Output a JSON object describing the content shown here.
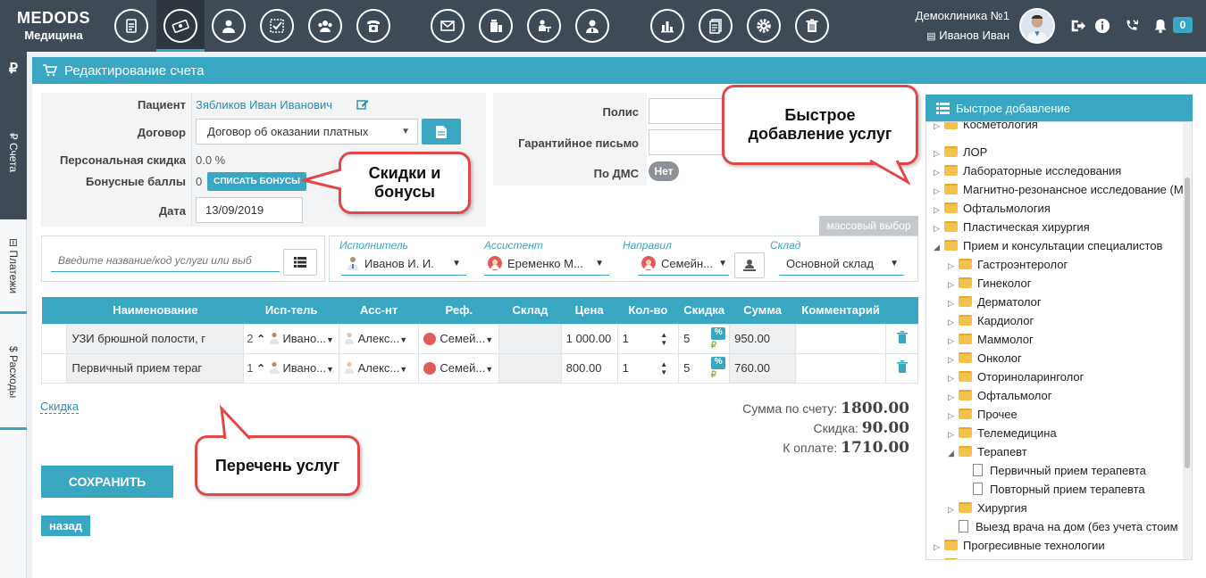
{
  "brand": {
    "name": "MEDODS",
    "sub": "Медицина"
  },
  "topbar": {
    "clinic": "Демоклиника №1",
    "user": "Иванов Иван",
    "notifications": "0"
  },
  "sidebar": {
    "currency": "₽",
    "tabs": [
      "₽ Счета",
      "⊟ Платежи",
      "$ Расходы"
    ]
  },
  "page": {
    "title": "Редактирование счета"
  },
  "patient": {
    "label_patient": "Пациент",
    "name": "Зябликов Иван Иванович",
    "label_contract": "Договор",
    "contract": "Договор об оказании платных",
    "label_discount": "Персональная скидка",
    "discount": "0.0 %",
    "label_bonus": "Бонусные баллы",
    "bonus": "0",
    "bonus_button": "СПИСАТЬ БОНУСЫ",
    "label_date": "Дата",
    "date": "13/09/2019"
  },
  "insurance": {
    "label_policy": "Полис",
    "label_letter": "Гарантийное письмо",
    "label_dms": "По ДМС",
    "dms_toggle": "Нет"
  },
  "mass_select": "массовый выбор",
  "search": {
    "placeholder": "Введите название/код услуги или выб"
  },
  "filters": {
    "performer_label": "Исполнитель",
    "performer": "Иванов И. И.",
    "assistant_label": "Ассистент",
    "assistant": "Еременко М...",
    "referrer_label": "Направил",
    "referrer": "Семейн...",
    "warehouse_label": "Склад",
    "warehouse": "Основной склад"
  },
  "table": {
    "headers": [
      "Наименование",
      "Исп-тель",
      "Асс-нт",
      "Реф.",
      "Склад",
      "Цена",
      "Кол-во",
      "Скидка",
      "Сумма",
      "Комментарий"
    ],
    "rows": [
      {
        "name": "УЗИ брюшной полости, г",
        "order": "2",
        "performer": "Ивано...",
        "assistant": "Алекс...",
        "ref": "Семей...",
        "price": "1 000.00",
        "qty": "1",
        "discount": "5",
        "sum": "950.00"
      },
      {
        "name": "Первичный прием тераг",
        "order": "1",
        "performer": "Ивано...",
        "assistant": "Алекс...",
        "ref": "Семей...",
        "price": "800.00",
        "qty": "1",
        "discount": "5",
        "sum": "760.00"
      }
    ]
  },
  "discount_link": "Скидка",
  "totals": {
    "sum_label": "Сумма по счету:",
    "sum": "1800.00",
    "discount_label": "Скидка:",
    "discount": "90.00",
    "pay_label": "К оплате:",
    "pay": "1710.00"
  },
  "actions": {
    "save": "СОХРАНИТЬ",
    "back": "назад"
  },
  "quick_add": {
    "title": "Быстрое добавление",
    "items": [
      {
        "label": "Косметология",
        "level": 0,
        "type": "folder"
      },
      {
        "label": "ЛОР",
        "level": 0,
        "type": "folder"
      },
      {
        "label": "Лабораторные исследования",
        "level": 0,
        "type": "folder"
      },
      {
        "label": "Магнитно-резонансное исследование (М",
        "level": 0,
        "type": "folder"
      },
      {
        "label": "Офтальмология",
        "level": 0,
        "type": "folder"
      },
      {
        "label": "Пластическая хирургия",
        "level": 0,
        "type": "folder"
      },
      {
        "label": "Прием и консультации специалистов",
        "level": 0,
        "type": "folder-open"
      },
      {
        "label": "Гастроэнтеролог",
        "level": 1,
        "type": "folder"
      },
      {
        "label": "Гинеколог",
        "level": 1,
        "type": "folder"
      },
      {
        "label": "Дерматолог",
        "level": 1,
        "type": "folder"
      },
      {
        "label": "Кардиолог",
        "level": 1,
        "type": "folder"
      },
      {
        "label": "Маммолог",
        "level": 1,
        "type": "folder"
      },
      {
        "label": "Онколог",
        "level": 1,
        "type": "folder"
      },
      {
        "label": "Оториноларинголог",
        "level": 1,
        "type": "folder"
      },
      {
        "label": "Офтальмолог",
        "level": 1,
        "type": "folder"
      },
      {
        "label": "Прочее",
        "level": 1,
        "type": "folder"
      },
      {
        "label": "Телемедицина",
        "level": 1,
        "type": "folder"
      },
      {
        "label": "Терапевт",
        "level": 1,
        "type": "folder-open"
      },
      {
        "label": "Первичный прием терапевта",
        "level": 2,
        "type": "file"
      },
      {
        "label": "Повторный прием терапевта",
        "level": 2,
        "type": "file"
      },
      {
        "label": "Хирургия",
        "level": 1,
        "type": "folder"
      },
      {
        "label": "Выезд врача на дом (без учета стоим",
        "level": 1,
        "type": "file"
      },
      {
        "label": "Прогресивные технологии",
        "level": 0,
        "type": "folder"
      },
      {
        "label": "Р",
        "level": 0,
        "type": "folder"
      }
    ]
  },
  "callouts": {
    "discounts": "Скидки и бонусы",
    "quick": "Быстрое добавление услуг",
    "list": "Перечень услуг"
  },
  "colors": {
    "accent": "#3aa7c2",
    "topbar": "#3f4a57",
    "callout_border": "#e24747"
  }
}
